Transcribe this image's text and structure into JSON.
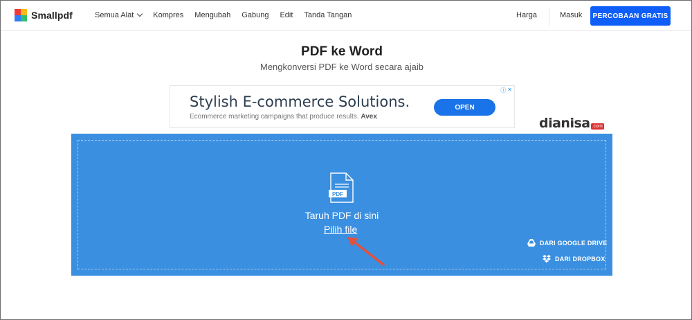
{
  "header": {
    "brand": "Smallpdf",
    "nav": [
      {
        "label": "Semua Alat",
        "has_dropdown": true
      },
      {
        "label": "Kompres"
      },
      {
        "label": "Mengubah"
      },
      {
        "label": "Gabung"
      },
      {
        "label": "Edit"
      },
      {
        "label": "Tanda Tangan"
      }
    ],
    "pricing": "Harga",
    "login": "Masuk",
    "trial_button": "PERCOBAAN GRATIS"
  },
  "page": {
    "title": "PDF ke Word",
    "subtitle": "Mengkonversi PDF ke Word secara ajaib"
  },
  "ad": {
    "headline": "Stylish E-commerce Solutions.",
    "description": "Ecommerce marketing campaigns that produce results.",
    "advertiser": "Avex",
    "cta": "OPEN"
  },
  "watermark": {
    "text": "dianisa",
    "suffix": ".com"
  },
  "dropzone": {
    "file_icon_label": "PDF",
    "drop_text": "Taruh PDF di sini",
    "pick_file": "Pilih file",
    "google_drive": "DARI GOOGLE DRIVE",
    "dropbox": "DARI DROPBOX"
  },
  "colors": {
    "brand_blue": "#0f5ef7",
    "dropzone_blue": "#3b8fe0",
    "ad_button": "#1a73e8",
    "annotation_arrow": "#e0523f"
  },
  "icons": {
    "logo": "smallpdf-logo-icon",
    "chevron": "chevron-down-icon",
    "file": "pdf-file-icon",
    "google_drive": "google-drive-icon",
    "dropbox": "dropbox-icon",
    "annotation": "red-arrow-annotation"
  }
}
